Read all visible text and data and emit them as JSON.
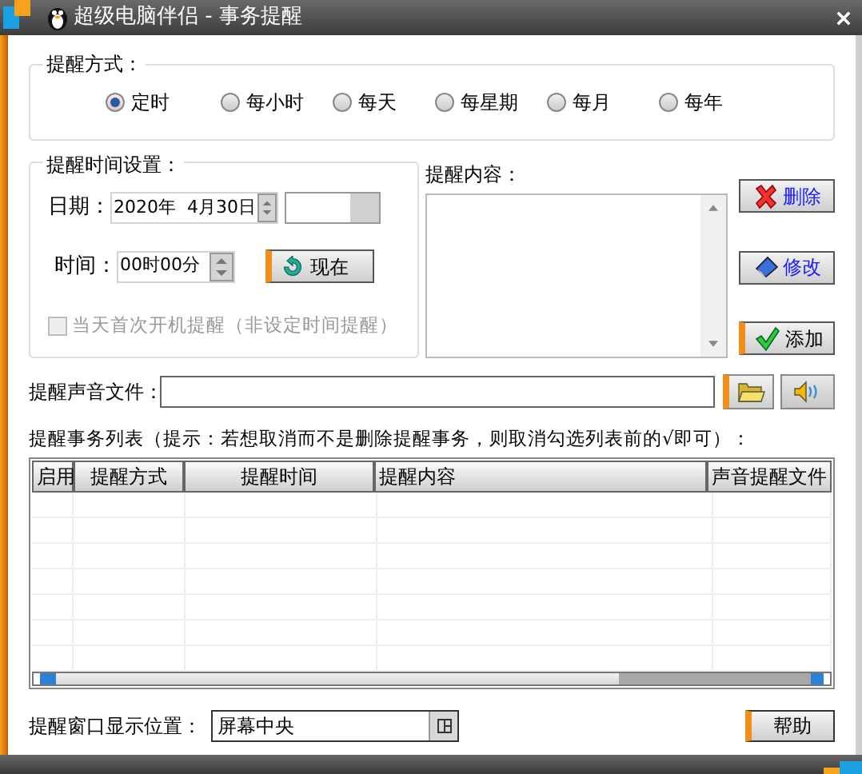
{
  "window": {
    "title": "超级电脑伴侣 - 事务提醒"
  },
  "reminder_mode": {
    "label": "提醒方式：",
    "options": [
      {
        "label": "定时",
        "selected": true
      },
      {
        "label": "每小时",
        "selected": false
      },
      {
        "label": "每天",
        "selected": false
      },
      {
        "label": "每星期",
        "selected": false
      },
      {
        "label": "每月",
        "selected": false
      },
      {
        "label": "每年",
        "selected": false
      }
    ]
  },
  "time_settings": {
    "label": "提醒时间设置：",
    "date": {
      "label": "日期：",
      "value": "2020年  4月30日"
    },
    "time": {
      "label": "时间：",
      "value": "00时00分"
    },
    "now_button": "现在",
    "startup_checkbox": {
      "label": "当天首次开机提醒（非设定时间提醒）",
      "checked": false,
      "disabled": true
    }
  },
  "content": {
    "label": "提醒内容："
  },
  "actions": [
    {
      "label": "删除",
      "kind": "delete"
    },
    {
      "label": "修改",
      "kind": "edit"
    },
    {
      "label": "添加",
      "kind": "add"
    }
  ],
  "sound": {
    "label": "提醒声音文件："
  },
  "list": {
    "hint": "提醒事务列表（提示：若想取消而不是删除提醒事务，则取消勾选列表前的√即可）：",
    "columns": [
      "启用",
      "提醒方式",
      "提醒时间",
      "提醒内容",
      "声音提醒文件"
    ]
  },
  "position": {
    "label": "提醒窗口显示位置：",
    "value": "屏幕中央"
  },
  "help_button": "帮助"
}
